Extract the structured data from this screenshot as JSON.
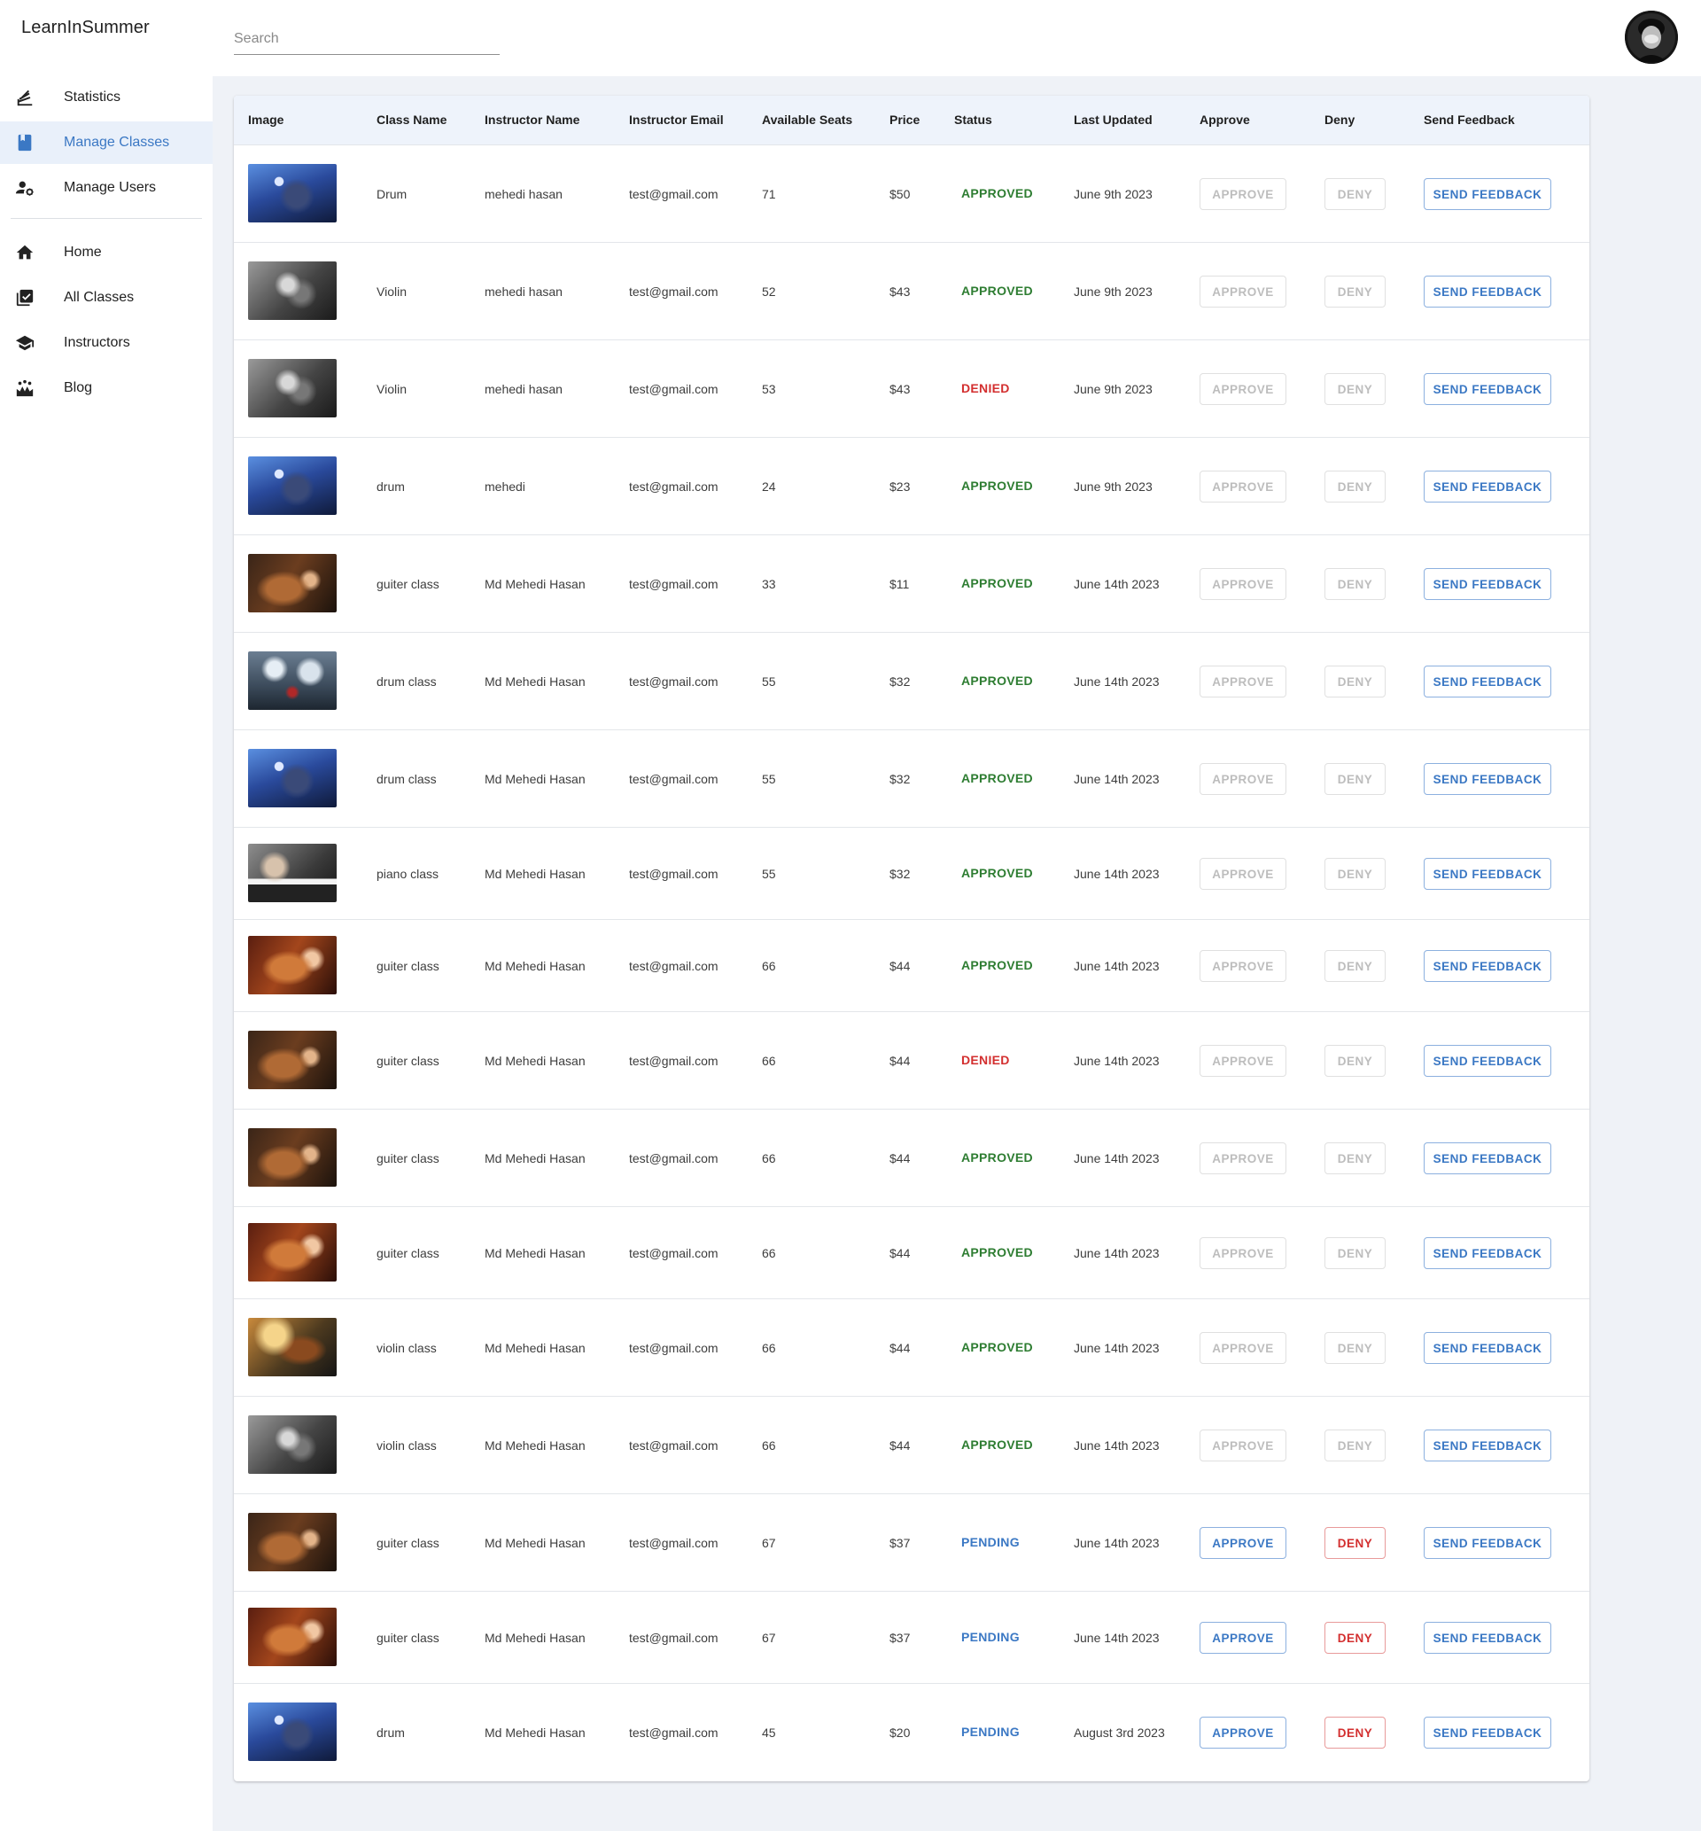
{
  "app": {
    "title": "LearnInSummer"
  },
  "search": {
    "placeholder": "Search"
  },
  "sidebar": {
    "items": [
      {
        "label": "Statistics",
        "icon": "statistics-icon",
        "active": false
      },
      {
        "label": "Manage Classes",
        "icon": "book-icon",
        "active": true
      },
      {
        "label": "Manage Users",
        "icon": "manage-users-icon",
        "active": false
      }
    ],
    "items2": [
      {
        "label": "Home",
        "icon": "home-icon",
        "active": false
      },
      {
        "label": "All Classes",
        "icon": "library-check-icon",
        "active": false
      },
      {
        "label": "Instructors",
        "icon": "school-icon",
        "active": false
      },
      {
        "label": "Blog",
        "icon": "blog-icon",
        "active": false
      }
    ]
  },
  "table": {
    "headers": [
      "Image",
      "Class Name",
      "Instructor Name",
      "Instructor Email",
      "Available Seats",
      "Price",
      "Status",
      "Last Updated",
      "Approve",
      "Deny",
      "Send Feedback"
    ],
    "buttons": {
      "approve": "APPROVE",
      "deny": "DENY",
      "feedback": "SEND FEEDBACK"
    },
    "status_labels": {
      "approved": "APPROVED",
      "denied": "DENIED",
      "pending": "PENDING"
    },
    "rows": [
      {
        "image": "drum-blue",
        "class_name": "Drum",
        "instructor": "mehedi hasan",
        "email": "test@gmail.com",
        "seats": "71",
        "price": "$50",
        "status": "approved",
        "updated": "June 9th 2023"
      },
      {
        "image": "violin-bw",
        "class_name": "Violin",
        "instructor": "mehedi hasan",
        "email": "test@gmail.com",
        "seats": "52",
        "price": "$43",
        "status": "approved",
        "updated": "June 9th 2023"
      },
      {
        "image": "violin-bw",
        "class_name": "Violin",
        "instructor": "mehedi hasan",
        "email": "test@gmail.com",
        "seats": "53",
        "price": "$43",
        "status": "denied",
        "updated": "June 9th 2023"
      },
      {
        "image": "drum-blue",
        "class_name": "drum",
        "instructor": "mehedi",
        "email": "test@gmail.com",
        "seats": "24",
        "price": "$23",
        "status": "approved",
        "updated": "June 9th 2023"
      },
      {
        "image": "guitar-dark",
        "class_name": "guiter class",
        "instructor": "Md Mehedi Hasan",
        "email": "test@gmail.com",
        "seats": "33",
        "price": "$11",
        "status": "approved",
        "updated": "June 14th 2023"
      },
      {
        "image": "drum-kit",
        "class_name": "drum class",
        "instructor": "Md Mehedi Hasan",
        "email": "test@gmail.com",
        "seats": "55",
        "price": "$32",
        "status": "approved",
        "updated": "June 14th 2023"
      },
      {
        "image": "drum-blue",
        "class_name": "drum class",
        "instructor": "Md Mehedi Hasan",
        "email": "test@gmail.com",
        "seats": "55",
        "price": "$32",
        "status": "approved",
        "updated": "June 14th 2023"
      },
      {
        "image": "piano",
        "class_name": "piano class",
        "instructor": "Md Mehedi Hasan",
        "email": "test@gmail.com",
        "seats": "55",
        "price": "$32",
        "status": "approved",
        "updated": "June 14th 2023"
      },
      {
        "image": "guitar-warm",
        "class_name": "guiter class",
        "instructor": "Md Mehedi Hasan",
        "email": "test@gmail.com",
        "seats": "66",
        "price": "$44",
        "status": "approved",
        "updated": "June 14th 2023"
      },
      {
        "image": "guitar-dark",
        "class_name": "guiter class",
        "instructor": "Md Mehedi Hasan",
        "email": "test@gmail.com",
        "seats": "66",
        "price": "$44",
        "status": "denied",
        "updated": "June 14th 2023"
      },
      {
        "image": "guitar-dark",
        "class_name": "guiter class",
        "instructor": "Md Mehedi Hasan",
        "email": "test@gmail.com",
        "seats": "66",
        "price": "$44",
        "status": "approved",
        "updated": "June 14th 2023"
      },
      {
        "image": "guitar-warm",
        "class_name": "guiter class",
        "instructor": "Md Mehedi Hasan",
        "email": "test@gmail.com",
        "seats": "66",
        "price": "$44",
        "status": "approved",
        "updated": "June 14th 2023"
      },
      {
        "image": "violin-sunset",
        "class_name": "violin class",
        "instructor": "Md Mehedi Hasan",
        "email": "test@gmail.com",
        "seats": "66",
        "price": "$44",
        "status": "approved",
        "updated": "June 14th 2023"
      },
      {
        "image": "violin-bw",
        "class_name": "violin class",
        "instructor": "Md Mehedi Hasan",
        "email": "test@gmail.com",
        "seats": "66",
        "price": "$44",
        "status": "approved",
        "updated": "June 14th 2023"
      },
      {
        "image": "guitar-dark",
        "class_name": "guiter class",
        "instructor": "Md Mehedi Hasan",
        "email": "test@gmail.com",
        "seats": "67",
        "price": "$37",
        "status": "pending",
        "updated": "June 14th 2023"
      },
      {
        "image": "guitar-warm",
        "class_name": "guiter class",
        "instructor": "Md Mehedi Hasan",
        "email": "test@gmail.com",
        "seats": "67",
        "price": "$37",
        "status": "pending",
        "updated": "June 14th 2023"
      },
      {
        "image": "drum-blue",
        "class_name": "drum",
        "instructor": "Md Mehedi Hasan",
        "email": "test@gmail.com",
        "seats": "45",
        "price": "$20",
        "status": "pending",
        "updated": "August 3rd 2023"
      }
    ]
  },
  "colors": {
    "accent": "#3b78c4",
    "approved": "#2e7d32",
    "denied": "#d32f2f",
    "pending": "#3b78c4",
    "content_bg": "#eff2f7",
    "header_bg": "#eef3fb",
    "active_nav_bg": "#e9f0fa"
  }
}
